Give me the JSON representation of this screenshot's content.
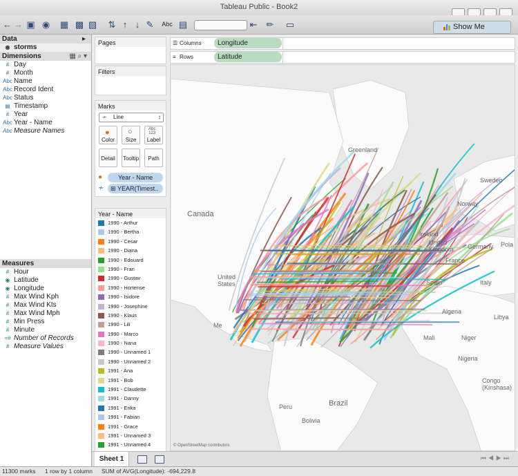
{
  "window": {
    "title": "Tableau Public - Book2"
  },
  "toolbar": {
    "abc_label": "Abc",
    "show_me_label": "Show Me",
    "show_me_colors": [
      "#e46c0a",
      "#4f81bd",
      "#9bbb59"
    ]
  },
  "data_pane": {
    "title": "Data",
    "source": "storms",
    "dimensions_title": "Dimensions",
    "dimensions": [
      {
        "type": "#",
        "name": "Day"
      },
      {
        "type": "#",
        "name": "Month"
      },
      {
        "type": "Abc",
        "name": "Name"
      },
      {
        "type": "Abc",
        "name": "Record Ident"
      },
      {
        "type": "Abc",
        "name": "Status"
      },
      {
        "type": "cal",
        "name": "Timestamp"
      },
      {
        "type": "#",
        "name": "Year"
      },
      {
        "type": "Abc",
        "name": "Year - Name"
      },
      {
        "type": "Abc",
        "name": "Measure Names"
      }
    ],
    "measures_title": "Measures",
    "measures": [
      {
        "type": "#",
        "name": "Hour"
      },
      {
        "type": "geo",
        "name": "Latitude"
      },
      {
        "type": "geo",
        "name": "Longitude"
      },
      {
        "type": "#",
        "name": "Max Wind Kph"
      },
      {
        "type": "#",
        "name": "Max Wind Kts"
      },
      {
        "type": "#",
        "name": "Max Wind Mph"
      },
      {
        "type": "#",
        "name": "Min Press"
      },
      {
        "type": "#",
        "name": "Minute"
      },
      {
        "type": "=#",
        "name": "Number of Records"
      },
      {
        "type": "#",
        "name": "Measure Values"
      }
    ]
  },
  "cards": {
    "pages": "Pages",
    "filters": "Filters",
    "marks": "Marks",
    "mark_type": "Line",
    "buttons": {
      "color": "Color",
      "size": "Size",
      "label": "Label",
      "detail": "Detail",
      "tooltip": "Tooltip",
      "path": "Path"
    },
    "label_glyph": "Abc\n123",
    "pill_color": "Year - Name",
    "pill_path": "YEAR(Timest.."
  },
  "shelves": {
    "columns_label": "Columns",
    "columns_value": "Longitude",
    "rows_label": "Rows",
    "rows_value": "Latitude"
  },
  "legend": {
    "title": "Year - Name",
    "items": [
      {
        "label": "1990 - Arthur",
        "color": "#1f77b4"
      },
      {
        "label": "1990 - Bertha",
        "color": "#aec7e8"
      },
      {
        "label": "1990 - Cesar",
        "color": "#ff7f0e"
      },
      {
        "label": "1990 - Diana",
        "color": "#ffbb78"
      },
      {
        "label": "1990 - Edouard",
        "color": "#2ca02c"
      },
      {
        "label": "1990 - Fran",
        "color": "#98df8a"
      },
      {
        "label": "1990 - Gustav",
        "color": "#d62728"
      },
      {
        "label": "1990 - Hortense",
        "color": "#ff9896"
      },
      {
        "label": "1990 - Isidore",
        "color": "#9467bd"
      },
      {
        "label": "1990 - Josephine",
        "color": "#c5b0d5"
      },
      {
        "label": "1990 - Klaus",
        "color": "#8c564b"
      },
      {
        "label": "1990 - Lili",
        "color": "#c49c94"
      },
      {
        "label": "1990 - Marco",
        "color": "#e377c2"
      },
      {
        "label": "1990 - Nana",
        "color": "#f7b6d2"
      },
      {
        "label": "1990 - Unnamed 1",
        "color": "#7f7f7f"
      },
      {
        "label": "1990 - Unnamed 2",
        "color": "#c7c7c7"
      },
      {
        "label": "1991 - Ana",
        "color": "#bcbd22"
      },
      {
        "label": "1991 - Bob",
        "color": "#dbdb8d"
      },
      {
        "label": "1991 - Claudette",
        "color": "#17becf"
      },
      {
        "label": "1991 - Danny",
        "color": "#9edae5"
      },
      {
        "label": "1991 - Erika",
        "color": "#1f77b4"
      },
      {
        "label": "1991 - Fabian",
        "color": "#aec7e8"
      },
      {
        "label": "1991 - Grace",
        "color": "#ff7f0e"
      },
      {
        "label": "1991 - Unnamed 3",
        "color": "#ffbb78"
      },
      {
        "label": "1991 - Unnamed 4",
        "color": "#2ca02c"
      }
    ]
  },
  "map": {
    "labels": {
      "greenland": "Greenland",
      "canada": "Canada",
      "sweden": "Sweden",
      "norway": "Norway",
      "united_states": "United\nStates",
      "me": "Me",
      "ireland": "Ireland",
      "united_kingdom": "United\nKingdom",
      "poland": "Pola",
      "germany": "Germany",
      "france": "France",
      "spain": "Spain",
      "italy": "Italy",
      "algeria": "Algeria",
      "libya": "Libya",
      "mali": "Mali",
      "niger": "Niger",
      "nigeria": "Nigeria",
      "congo": "Congo\n(Kinshasa)",
      "brazil": "Brazil",
      "peru": "Peru",
      "bolivia": "Bolivia"
    },
    "attribution": "© OpenStreetMap contributors",
    "track_colors": [
      "#1f77b4",
      "#aec7e8",
      "#ff7f0e",
      "#ffbb78",
      "#2ca02c",
      "#98df8a",
      "#d62728",
      "#ff9896",
      "#9467bd",
      "#c5b0d5",
      "#8c564b",
      "#c49c94",
      "#e377c2",
      "#f7b6d2",
      "#7f7f7f",
      "#c7c7c7",
      "#bcbd22",
      "#dbdb8d",
      "#17becf",
      "#9edae5"
    ]
  },
  "sheets": {
    "active": "Sheet 1"
  },
  "status": {
    "marks": "11300 marks",
    "rows": "1 row by 1 column",
    "sum": "SUM of AVG(Longitude): -694,229.8"
  }
}
